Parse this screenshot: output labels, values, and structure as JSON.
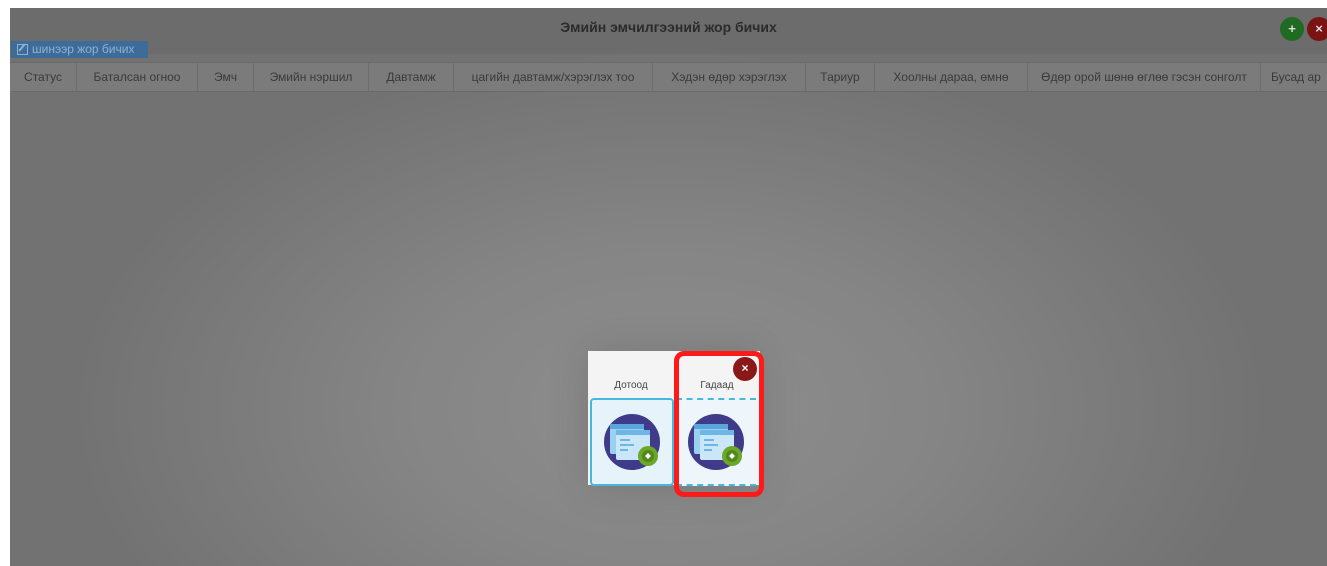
{
  "window": {
    "title": "Эмийн эмчилгээний жор бичих",
    "tab_button_label": "шинээр жор бичих",
    "add_symbol": "+",
    "close_symbol": "×"
  },
  "table": {
    "columns": [
      "Статус",
      "Баталсан огноо",
      "Эмч",
      "Эмийн нэршил",
      "Давтамж",
      "цагийн давтамж/хэрэглэх тоо",
      "Хэдэн өдөр хэрэглэх",
      "Тариур",
      "Хоолны дараа, өмнө",
      "Өдөр орой шөнө өглөө гэсэн сонголт",
      "Бусад ар"
    ]
  },
  "modal": {
    "close_symbol": "×",
    "options": [
      {
        "label": "Дотоод",
        "icon": "web-app-settings-icon"
      },
      {
        "label": "Гадаад",
        "icon": "web-app-settings-icon"
      }
    ]
  },
  "colors": {
    "overlay": "#7a7a7a",
    "accent_blue": "#45b8e0",
    "highlight_red": "#ff1a1a",
    "add_green": "#1f6b22",
    "close_red": "#8a1818"
  }
}
